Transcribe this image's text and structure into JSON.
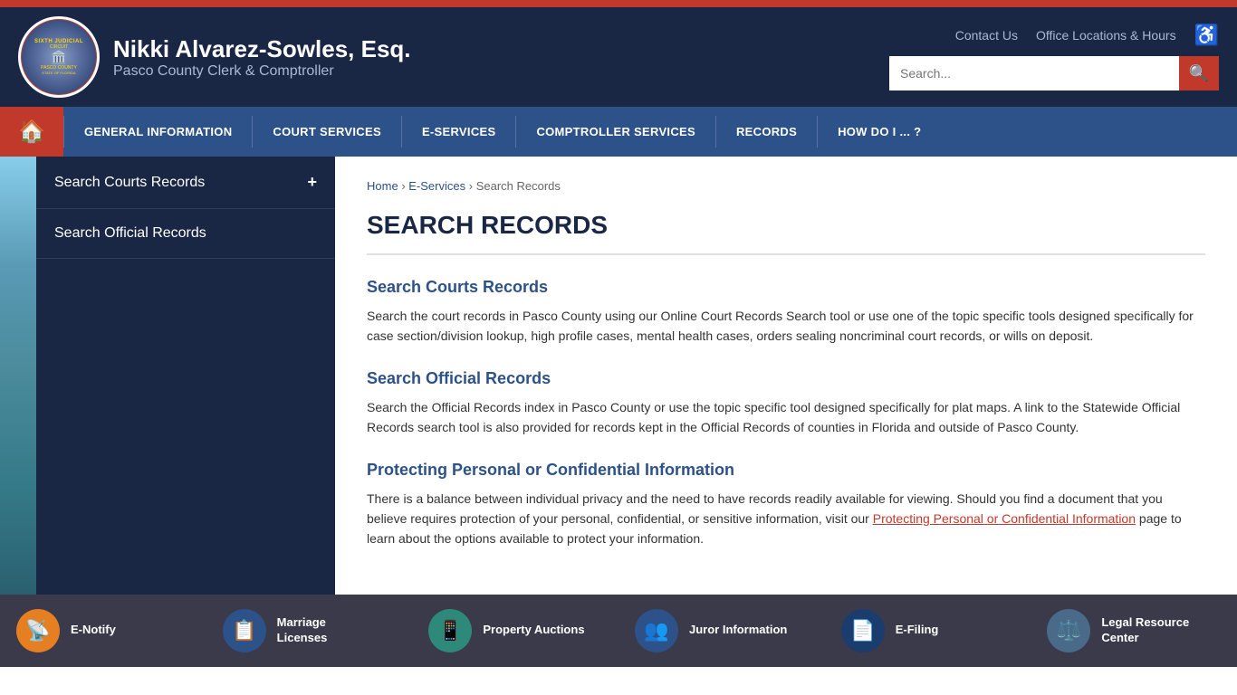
{
  "topbar": {
    "contact_us": "Contact Us",
    "office_locations": "Office Locations & Hours"
  },
  "header": {
    "name": "Nikki Alvarez-Sowles, Esq.",
    "title": "Pasco County Clerk & Comptroller",
    "search_placeholder": "Search..."
  },
  "nav": {
    "home_label": "🏠",
    "items": [
      {
        "label": "GENERAL INFORMATION"
      },
      {
        "label": "COURT SERVICES"
      },
      {
        "label": "E-SERVICES"
      },
      {
        "label": "COMPTROLLER SERVICES"
      },
      {
        "label": "RECORDS"
      },
      {
        "label": "HOW DO I ... ?"
      }
    ]
  },
  "sidebar": {
    "items": [
      {
        "label": "Search Courts Records",
        "has_plus": true
      },
      {
        "label": "Search Official Records",
        "has_plus": false
      }
    ]
  },
  "breadcrumb": {
    "home": "Home",
    "section": "E-Services",
    "current": "Search Records"
  },
  "main": {
    "page_title": "SEARCH RECORDS",
    "sections": [
      {
        "heading": "Search Courts Records",
        "body": "Search the court records in Pasco County using our Online Court Records Search tool or use one of the topic specific tools designed specifically for case section/division lookup, high profile cases, mental health cases, orders sealing noncriminal court records, or wills on deposit."
      },
      {
        "heading": "Search Official Records",
        "body": "Search the Official Records index in Pasco County or use the topic specific tool designed specifically for plat maps. A link to the Statewide Official Records search tool is also provided for records kept in the Official Records of counties in Florida and outside of Pasco County."
      },
      {
        "heading": "Protecting Personal or Confidential Information",
        "body_prefix": "There is a balance between individual privacy and the need to have records readily available for viewing. Should you find a document that you believe requires protection of your personal, confidential, or sensitive information, visit our ",
        "link_text": "Protecting Personal or Confidential Information",
        "body_suffix": " page to learn about the options available to protect your information."
      }
    ]
  },
  "footer": {
    "items": [
      {
        "label": "E-Notify",
        "icon": "📡",
        "icon_class": "orange"
      },
      {
        "label": "Marriage\nLicenses",
        "icon": "📋",
        "icon_class": "blue"
      },
      {
        "label": "Property Auctions",
        "icon": "📱",
        "icon_class": "teal"
      },
      {
        "label": "Juror Information",
        "icon": "👥",
        "icon_class": "blue"
      },
      {
        "label": "E-Filing",
        "icon": "📄",
        "icon_class": "dark-blue"
      },
      {
        "label": "Legal Resource\nCenter",
        "icon": "⚖️",
        "icon_class": "gray-blue"
      }
    ]
  },
  "colors": {
    "accent_red": "#c0392b",
    "navy": "#1a2744",
    "blue": "#2d5189"
  }
}
